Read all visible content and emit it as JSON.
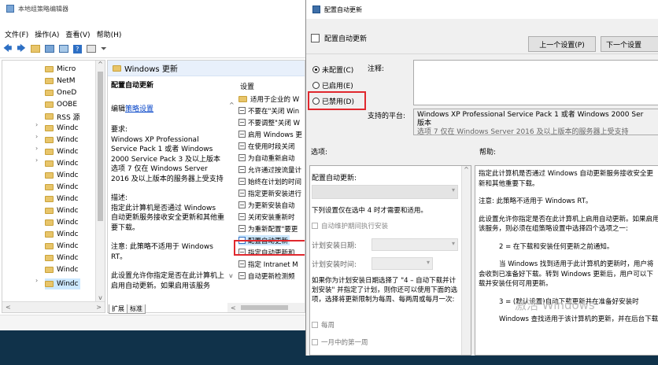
{
  "left_window": {
    "title": "本地组策略编辑器",
    "menu": [
      "文件(F)",
      "操作(A)",
      "查看(V)",
      "帮助(H)"
    ],
    "tree": [
      "Micro",
      "NetM",
      "OneD",
      "OOBE",
      "RSS 源",
      "Windc",
      "Windc",
      "Windc",
      "Windc",
      "Windc",
      "Windc",
      "Windc",
      "Windc",
      "Windc",
      "Windc",
      "Windc",
      "Windc",
      "Windc",
      "Windc"
    ],
    "breadcrumb_title": "Windows 更新",
    "desc": {
      "policy_title": "配置自动更新",
      "edit_prefix": "编辑",
      "edit_link": "策略设置",
      "req_label": "要求:",
      "req_text": "Windows XP Professional Service Pack 1 或者 Windows 2000 Service Pack 3 及以上版本 选项 7 仅在 Windows Server 2016 及以上版本的服务器上受支持",
      "desc_label": "描述:",
      "desc_text": "指定此计算机是否通过 Windows 自动更新服务接收安全更新和其他重要下载。",
      "note_text": "注意: 此策略不适用于 Windows RT。",
      "more_text": "此设置允许你指定是否在此计算机上启用自动更新。如果启用该服务"
    },
    "settings_header": "设置",
    "settings": [
      "适用于企业的 W",
      "不要在\"关闭 Win",
      "不要调整\"关闭 W",
      "启用 Windows 更",
      "在使用时段关闭",
      "为自动重新启动",
      "允许通过按流量计",
      "始终在计划的时间",
      "指定更新安装进行",
      "为更新安装自动",
      "关闭安装重新时",
      "为重新配置\"要更",
      "配置自动更新",
      "指定自动更新和",
      "指定 Intranet M",
      "自动更新检测频"
    ],
    "tabs": [
      "扩展",
      "标准"
    ]
  },
  "dialog": {
    "title": "配置自动更新",
    "header_title": "配置自动更新",
    "prev_btn": "上一个设置(P)",
    "next_btn": "下一个设置",
    "radio_unconfigured": "未配置(C)",
    "radio_enabled": "已启用(E)",
    "radio_disabled": "已禁用(D)",
    "comment_label": "注释:",
    "support_label": "支持的平台:",
    "support_text_1": "Windows XP Professional Service Pack 1 或者 Windows 2000 Ser",
    "support_text_2": "版本",
    "support_text_3": "选项 7 仅在 Windows Server 2016 及以上版本的服务器上受支持",
    "options_label": "选项:",
    "help_label": "帮助:",
    "options": {
      "configure_label": "配置自动更新:",
      "hint": "下列设置仅在选中 4 时才需要和适用。",
      "maint_checkbox": "自动维护期间执行安装",
      "sched_day": "计划安装日期:",
      "sched_time": "计划安装时间:",
      "long_text": "如果你为计划安装日期选择了 \"4 – 自动下载并计划安装\" 并指定了计划，则你还可以使用下面的选项，选择将更新限制为每周、每两周或每月一次:",
      "weekly": "每周",
      "first_week": "一月中的第一周"
    },
    "help": {
      "p1": "指定此计算机是否通过 Windows 自动更新服务接收安全更新和其他重要下载。",
      "p2": "注意: 此策略不适用于 Windows RT。",
      "p3": "此设置允许你指定是否在此计算机上启用自动更新。如果启用该服务，则必须在组策略设置中选择四个选项之一:",
      "p4": "2 = 在下载和安装任何更新之前通知。",
      "p5": "当 Windows 找到适用于此计算机的更新时，用户将会收到已准备好下载。转到 Windows 更新后，用户可以下载并安装任何可用更新。",
      "p6": "3 = (默认设置)自动下载更新并在准备好安装时",
      "p7": "Windows 查找适用于该计算机的更新，并在后台下载"
    },
    "watermark": "激活 Windows"
  },
  "colors": {
    "highlight": "#cce8ff",
    "accent_red": "#e0282e"
  }
}
